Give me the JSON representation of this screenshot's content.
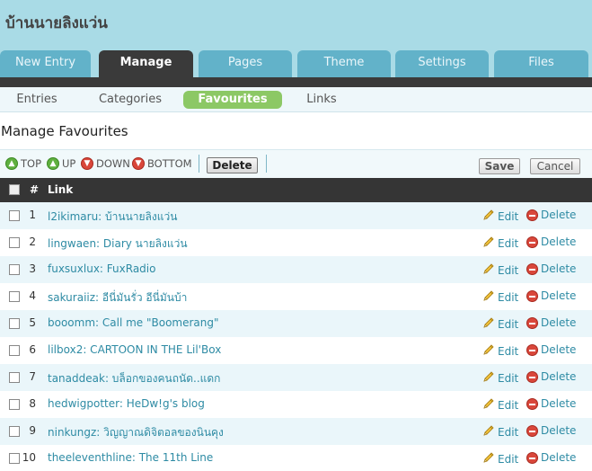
{
  "site": {
    "title": "บ้านนายลิงแว่น"
  },
  "main_tabs": [
    {
      "label": "New Entry"
    },
    {
      "label": "Manage"
    },
    {
      "label": "Pages"
    },
    {
      "label": "Theme"
    },
    {
      "label": "Settings"
    },
    {
      "label": "Files"
    }
  ],
  "sub_tabs": [
    {
      "label": "Entries"
    },
    {
      "label": "Categories"
    },
    {
      "label": "Favourites"
    },
    {
      "label": "Links"
    }
  ],
  "page": {
    "title": "Manage Favourites"
  },
  "toolbar": {
    "top": "TOP",
    "up": "UP",
    "down": "DOWN",
    "bottom": "BOTTOM",
    "delete": "Delete",
    "save": "Save",
    "cancel": "Cancel"
  },
  "table": {
    "col_num": "#",
    "col_link": "Link",
    "edit_label": "Edit",
    "delete_label": "Delete",
    "rows": [
      {
        "num": "1",
        "link": "l2ikimaru: บ้านนายลิงแว่น"
      },
      {
        "num": "2",
        "link": "lingwaen: Diary นายลิงแว่น"
      },
      {
        "num": "3",
        "link": "fuxsuxlux: FuxRadio"
      },
      {
        "num": "4",
        "link": "sakuraiiz: อีนี่มันรั่ว อีนี่มันบ้า"
      },
      {
        "num": "5",
        "link": "booomm: Call me \"Boomerang\""
      },
      {
        "num": "6",
        "link": "lilbox2: CARTOON IN THE Lil'Box"
      },
      {
        "num": "7",
        "link": "tanaddeak: บล็อกของคนถนัด..แดก"
      },
      {
        "num": "8",
        "link": "hedwigpotter: HeDw!g's blog"
      },
      {
        "num": "9",
        "link": "ninkungz: วิญญาณดิจิตอลของนินคุง"
      },
      {
        "num": "10",
        "link": "theeleventhline: The 11th Line"
      }
    ]
  }
}
